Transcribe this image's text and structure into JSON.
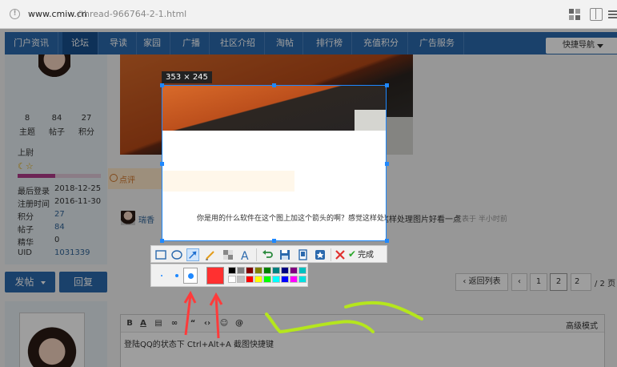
{
  "browser": {
    "url_domain": "www.cmiw.cn",
    "url_path": "/thread-966764-2-1.html"
  },
  "nav": {
    "items": [
      "门户资讯",
      "论坛",
      "导读",
      "家园",
      "广播",
      "社区介绍",
      "淘帖",
      "排行榜",
      "充值积分",
      "广告服务"
    ],
    "active_index": 1,
    "quick_nav": "快捷导航"
  },
  "user": {
    "stats": [
      {
        "value": "8",
        "label": "主题"
      },
      {
        "value": "84",
        "label": "帖子"
      },
      {
        "value": "27",
        "label": "积分"
      }
    ],
    "rank": "上尉",
    "info": [
      {
        "label": "最后登录",
        "value": "2018-12-25"
      },
      {
        "label": "注册时间",
        "value": "2016-11-30"
      },
      {
        "label": "积分",
        "value": "27"
      },
      {
        "label": "帖子",
        "value": "84"
      },
      {
        "label": "精华",
        "value": "0"
      },
      {
        "label": "UID",
        "value": "1031339"
      }
    ]
  },
  "post": {
    "rate_label": "点评",
    "comment_user": "瑞香",
    "comment_text": "你是用的什么软件在这个图上加这个箭头的啊？感觉这样处理图片好看一点",
    "comment_time": "发表于 半小时前"
  },
  "actions": {
    "post_button": "发帖",
    "reply_button": "回复",
    "back_list": "返回列表",
    "pages": [
      "1",
      "2"
    ],
    "current_page": "2",
    "page_total": "/ 2 页"
  },
  "editor": {
    "advanced_mode": "高级模式",
    "content": "登陆QQ的状态下  Ctrl+Alt+A   截图快捷键"
  },
  "capture": {
    "size_label": "353 × 245",
    "done_label": "完成",
    "current_color": "#ff3030",
    "swatches_row1": [
      "#000000",
      "#808080",
      "#800000",
      "#808000",
      "#008000",
      "#008080",
      "#000080",
      "#800080",
      "#00c0c0"
    ],
    "swatches_row2": [
      "#ffffff",
      "#c0c0c0",
      "#ff0000",
      "#ffff00",
      "#00ff00",
      "#00ffff",
      "#0000ff",
      "#ff00ff",
      "#00e0e0"
    ]
  },
  "colors": {
    "nav_blue": "#2b69ad",
    "selection_blue": "#1e88ff",
    "arrow_red": "#ff3b3b",
    "scribble_green": "#b5e61d"
  }
}
